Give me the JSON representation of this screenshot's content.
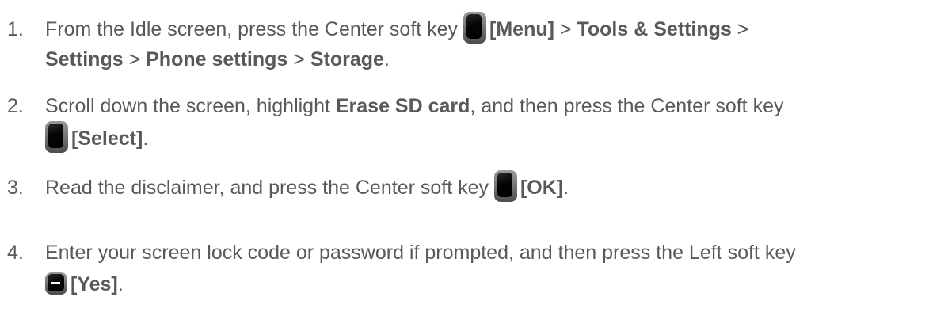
{
  "steps": [
    {
      "number": "1.",
      "parts": {
        "t1": "From the Idle screen, press the Center soft key ",
        "b1": "[Menu]",
        "t2": " > ",
        "b2": "Tools & Settings",
        "t3": " >",
        "b3": "Settings",
        "t4": " > ",
        "b4": "Phone settings",
        "t5": " > ",
        "b5": "Storage",
        "t6": "."
      }
    },
    {
      "number": "2.",
      "parts": {
        "t1": "Scroll down the screen, highlight ",
        "b1": "Erase SD card",
        "t2": ", and then press the Center soft key",
        "b2": "[Select]",
        "t3": "."
      }
    },
    {
      "number": "3.",
      "parts": {
        "t1": "Read the disclaimer, and press the Center soft key ",
        "b1": "[OK]",
        "t2": "."
      }
    },
    {
      "number": "4.",
      "parts": {
        "t1": "Enter your screen lock code or password if prompted, and then press the Left soft key",
        "b1": "[Yes]",
        "t2": "."
      }
    }
  ],
  "icons": {
    "center_key": "center-soft-key-icon",
    "left_key": "left-soft-key-icon"
  },
  "colors": {
    "text": "#595959",
    "background": "#ffffff"
  }
}
